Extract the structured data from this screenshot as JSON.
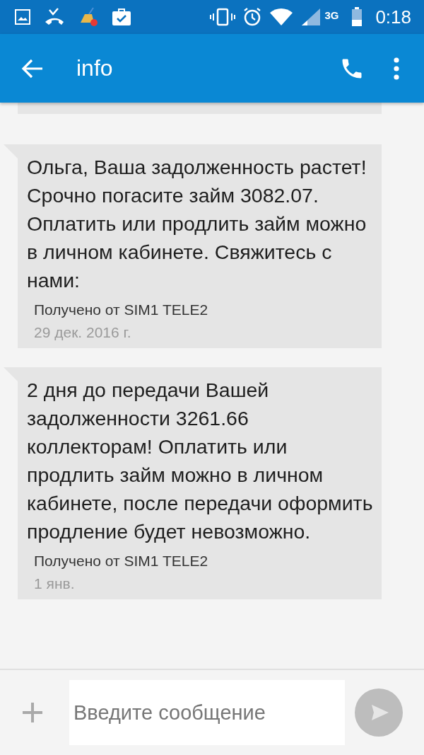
{
  "status_bar": {
    "time": "0:18",
    "network": "3G"
  },
  "toolbar": {
    "title": "info"
  },
  "messages": [
    {
      "text": "Ольга, Ваша задолженность растет! Срочно погасите займ 3082.07. Оплатить или продлить займ можно в личном кабинете. Свяжитесь с нами:",
      "source": "Получено от SIM1 TELE2",
      "date": "29 дек. 2016 г."
    },
    {
      "text": "2 дня до передачи Вашей задолженности 3261.66 коллекторам! Оплатить или продлить займ можно в личном кабинете, после передачи оформить продление будет невозможно.",
      "source": "Получено от SIM1 TELE2",
      "date": "1 янв."
    }
  ],
  "composer": {
    "placeholder": "Введите сообщение"
  }
}
